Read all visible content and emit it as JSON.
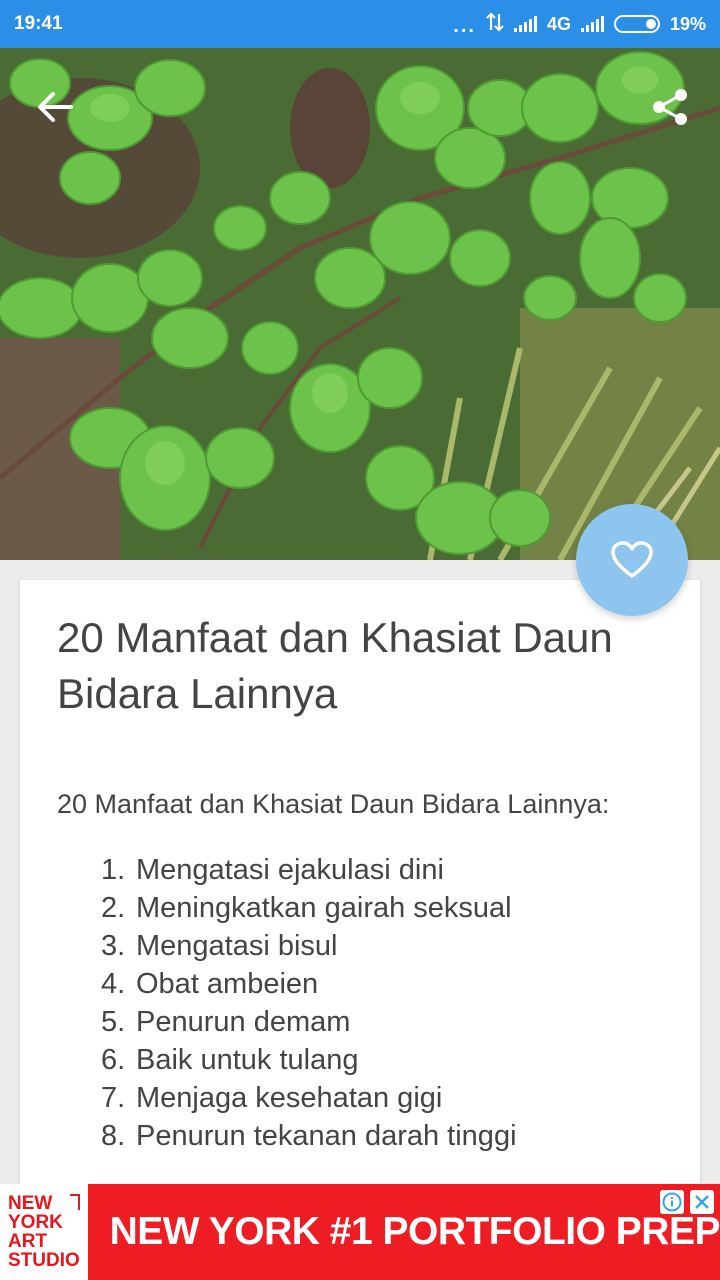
{
  "status_bar": {
    "time": "19:41",
    "network": "4G",
    "battery": "19%",
    "dots": "..."
  },
  "hero": {
    "image": "bidara-leaves-photo",
    "back_icon": "arrow-left-icon",
    "share_icon": "share-icon"
  },
  "favorite": {
    "icon": "heart-icon",
    "color": "#8ec5ef"
  },
  "article": {
    "title": "20 Manfaat dan Khasiat Daun Bidara Lainnya",
    "intro": "20 Manfaat dan Khasiat Daun Bidara Lainnya:",
    "items": [
      {
        "num": "1.",
        "text": "Mengatasi ejakulasi dini"
      },
      {
        "num": "2.",
        "text": "Meningkatkan gairah seksual"
      },
      {
        "num": "3.",
        "text": "Mengatasi bisul"
      },
      {
        "num": "4.",
        "text": "Obat ambeien"
      },
      {
        "num": "5.",
        "text": "Penurun demam"
      },
      {
        "num": "6.",
        "text": "Baik untuk tulang"
      },
      {
        "num": "7.",
        "text": "Menjaga kesehatan gigi"
      },
      {
        "num": "8.",
        "text": "Penurun tekanan darah tinggi"
      }
    ]
  },
  "ad": {
    "logo_lines": [
      "NEW",
      "YORK",
      "ART",
      "STUDIO"
    ],
    "headline": "NEW YORK #1 PORTFOLIO PREP",
    "brand_color": "#ee1d24"
  },
  "colors": {
    "status_bar": "#2b8fe8",
    "text": "#444444"
  }
}
